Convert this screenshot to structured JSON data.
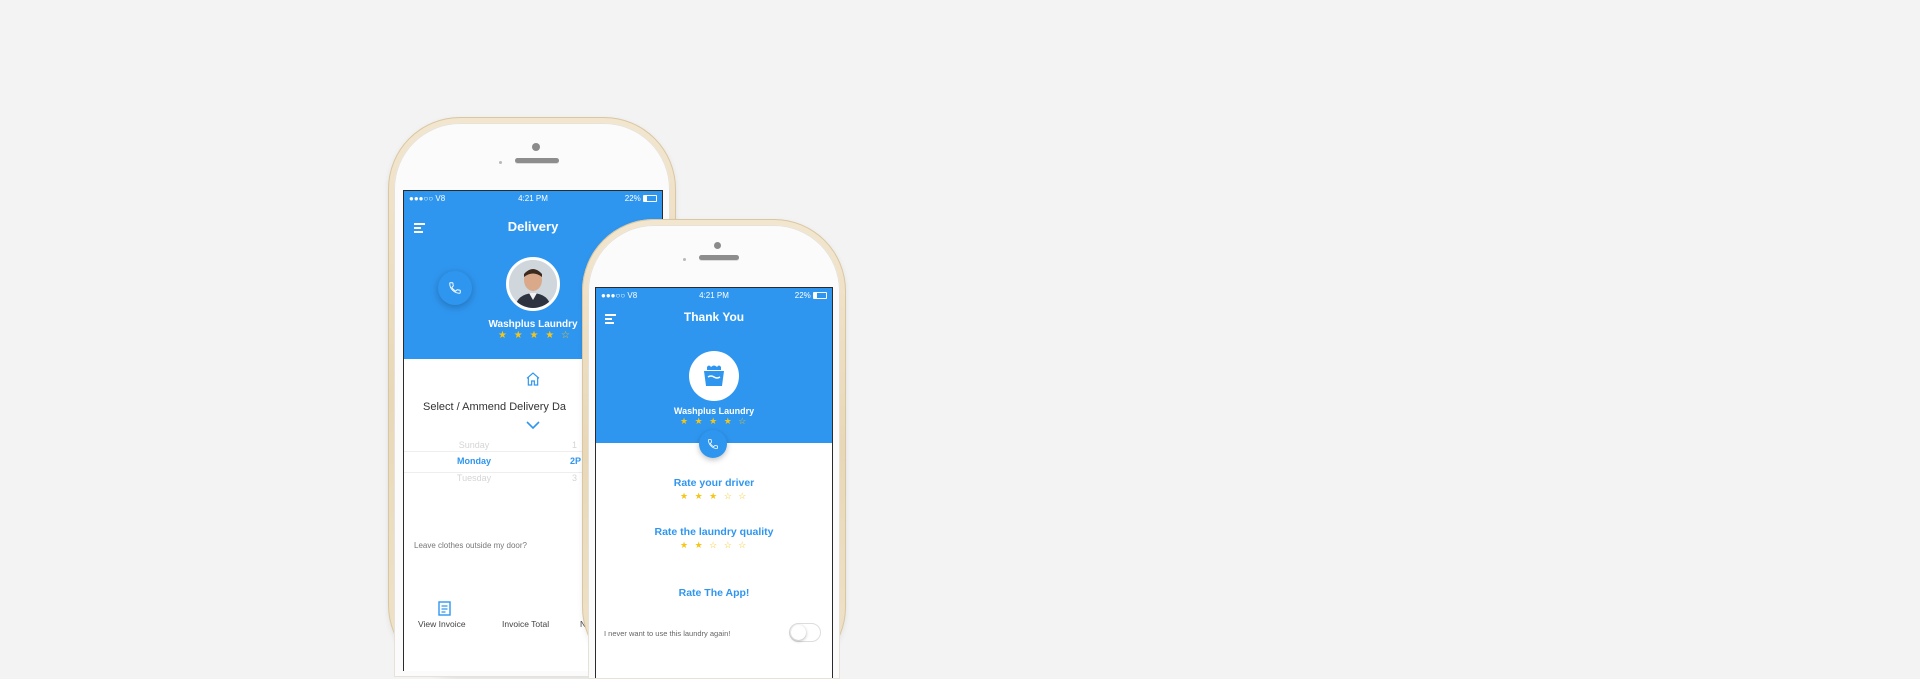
{
  "phone1": {
    "status": {
      "carrier": "●●●○○ V8 ",
      "time": "4:21 PM",
      "battery": "22%"
    },
    "title": "Delivery",
    "company": "Washplus Laundry",
    "rating": {
      "filled": "★ ★ ★ ★",
      "empty": "☆",
      "value": 4,
      "max": 5
    },
    "select_label": "Select / Ammend Delivery Da",
    "days": [
      "Sunday",
      "Monday",
      "Tuesday"
    ],
    "times": [
      "1",
      "2P",
      "3"
    ],
    "leave_clothes": "Leave clothes outside my door?",
    "bottom": {
      "invoice_label": "View Invoice",
      "total_label": "Invoice Total",
      "third_label": "N"
    }
  },
  "phone2": {
    "status": {
      "carrier": "●●●○○ V8 ",
      "time": "4:21 PM",
      "battery": "22%"
    },
    "title": "Thank You",
    "company": "Washplus Laundry",
    "rating": {
      "filled": "★ ★ ★ ★",
      "empty": "☆",
      "value": 4,
      "max": 5
    },
    "rate_driver": {
      "label": "Rate your driver",
      "filled": "★ ★ ★",
      "empty": "☆ ☆",
      "value": 3,
      "max": 5
    },
    "rate_quality": {
      "label": "Rate the laundry quality",
      "filled": "★ ★",
      "empty": "☆ ☆ ☆",
      "value": 2,
      "max": 5
    },
    "rate_app": "Rate The App!",
    "never_again": "I never want to use this laundry again!"
  },
  "colors": {
    "brand_blue": "#2f96ef",
    "star": "#f5c518"
  }
}
